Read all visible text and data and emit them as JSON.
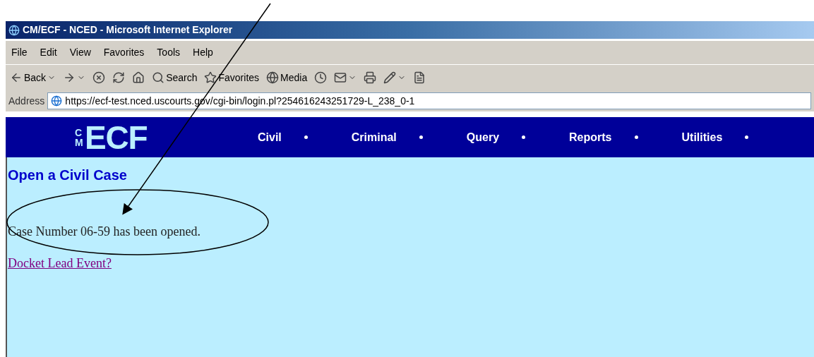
{
  "window": {
    "title": "CM/ECF - NCED - Microsoft Internet Explorer"
  },
  "menu": [
    "File",
    "Edit",
    "View",
    "Favorites",
    "Tools",
    "Help"
  ],
  "toolbar": [
    {
      "kind": "back",
      "label": "Back"
    },
    {
      "kind": "forward"
    },
    {
      "kind": "stop"
    },
    {
      "kind": "refresh"
    },
    {
      "kind": "home"
    },
    {
      "kind": "search",
      "label": "Search"
    },
    {
      "kind": "favorites",
      "label": "Favorites"
    },
    {
      "kind": "media",
      "label": "Media"
    },
    {
      "kind": "history"
    },
    {
      "kind": "mail"
    },
    {
      "kind": "print"
    },
    {
      "kind": "edit"
    },
    {
      "kind": "discuss"
    }
  ],
  "address": {
    "label": "Address",
    "value": "https://ecf-test.nced.uscourts.gov/cgi-bin/login.pl?254616243251729-L_238_0-1"
  },
  "site_nav": {
    "logo_small": "CM",
    "logo": "ECF",
    "items": [
      "Civil",
      "Criminal",
      "Query",
      "Reports",
      "Utilities"
    ]
  },
  "page": {
    "heading": "Open a Civil Case",
    "message": "Case Number 06-59 has been opened.",
    "link": {
      "text": "Docket Lead Event?",
      "visited": true
    }
  }
}
